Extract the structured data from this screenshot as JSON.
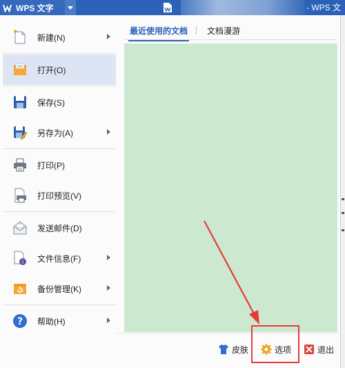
{
  "titlebar": {
    "app_menu_label": "WPS 文字",
    "window_title": "- WPS 文"
  },
  "menu": {
    "items": [
      {
        "label": "新建(N)",
        "icon": "new-document-icon",
        "has_submenu": true
      },
      {
        "label": "打开(O)",
        "icon": "open-folder-icon",
        "has_submenu": false,
        "active": true
      },
      {
        "label": "保存(S)",
        "icon": "save-disk-icon",
        "has_submenu": false
      },
      {
        "label": "另存为(A)",
        "icon": "save-as-icon",
        "has_submenu": true
      },
      {
        "label": "打印(P)",
        "icon": "printer-icon",
        "has_submenu": false
      },
      {
        "label": "打印预览(V)",
        "icon": "print-preview-icon",
        "has_submenu": false
      },
      {
        "label": "发送邮件(D)",
        "icon": "envelope-icon",
        "has_submenu": false
      },
      {
        "label": "文件信息(F)",
        "icon": "file-info-icon",
        "has_submenu": true
      },
      {
        "label": "备份管理(K)",
        "icon": "backup-icon",
        "has_submenu": true
      },
      {
        "label": "帮助(H)",
        "icon": "help-icon",
        "has_submenu": true
      }
    ]
  },
  "tabs": [
    {
      "label": "最近使用的文档",
      "active": true
    },
    {
      "label": "文档漫游",
      "active": false
    }
  ],
  "footer": {
    "skin_label": "皮肤",
    "options_label": "选项",
    "exit_label": "退出"
  },
  "colors": {
    "titlebar": "#2b62b8",
    "active_item": "#dde5f4",
    "docs_area": "#cde8d0",
    "accent": "#2a62b9",
    "annotation": "#e53a3a"
  }
}
